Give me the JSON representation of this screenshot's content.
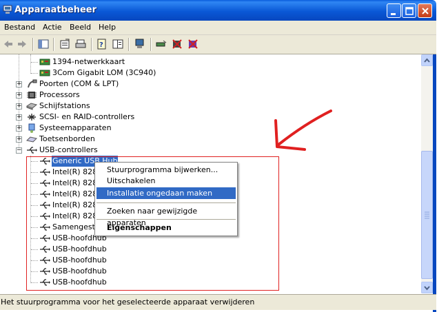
{
  "window": {
    "title": "Apparaatbeheer"
  },
  "menu": [
    "Bestand",
    "Actie",
    "Beeld",
    "Help"
  ],
  "toolbar_icons": [
    "back-icon",
    "forward-icon",
    "show-hide-tree-icon",
    "properties-icon",
    "print-icon",
    "help-icon",
    "view-icon",
    "computer-icon",
    "scan-hardware-icon",
    "disable-device-icon",
    "uninstall-device-icon"
  ],
  "tree": {
    "rows": [
      "1394-netwerkkaart",
      "3Com Gigabit LOM (3C940)",
      "Poorten (COM & LPT)",
      "Processors",
      "Schijfstations",
      "SCSI- en RAID-controllers",
      "Systeemapparaten",
      "Toetsenborden",
      "USB-controllers",
      "Generic USB Hub",
      "Intel(R) 828",
      "Intel(R) 828",
      "Intel(R) 828",
      "Intel(R) 828",
      "Intel(R) 828",
      "Samengeste",
      "USB-hoofdhub",
      "USB-hoofdhub",
      "USB-hoofdhub",
      "USB-hoofdhub",
      "USB-hoofdhub"
    ]
  },
  "context_menu": {
    "items": [
      "Stuurprogramma bijwerken...",
      "Uitschakelen",
      "Installatie ongedaan maken",
      "Zoeken naar gewijzigde apparaten",
      "Eigenschappen"
    ]
  },
  "status": {
    "text": "Het stuurprogramma voor het geselecteerde apparaat verwijderen"
  },
  "colors": {
    "title_bar": "#0a58d6",
    "selection": "#316ac5",
    "annotation": "#e02020"
  }
}
